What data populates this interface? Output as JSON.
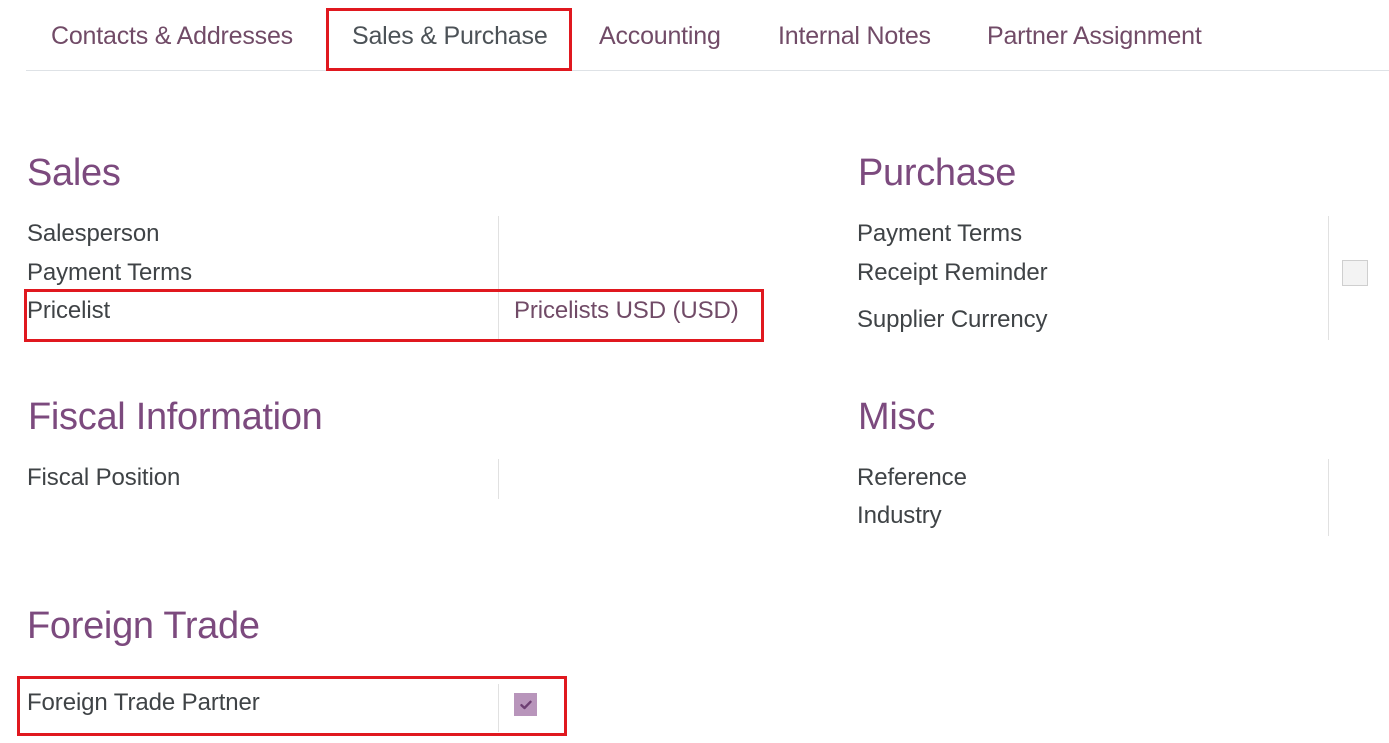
{
  "tabs": [
    {
      "label": "Contacts & Addresses",
      "active": false
    },
    {
      "label": "Sales & Purchase",
      "active": true
    },
    {
      "label": "Accounting",
      "active": false
    },
    {
      "label": "Internal Notes",
      "active": false
    },
    {
      "label": "Partner Assignment",
      "active": false
    }
  ],
  "sales": {
    "title": "Sales",
    "salesperson_label": "Salesperson",
    "payment_terms_label": "Payment Terms",
    "pricelist_label": "Pricelist",
    "pricelist_value": "Pricelists USD (USD)"
  },
  "purchase": {
    "title": "Purchase",
    "payment_terms_label": "Payment Terms",
    "receipt_reminder_label": "Receipt Reminder",
    "receipt_reminder_checked": false,
    "supplier_currency_label": "Supplier Currency"
  },
  "fiscal": {
    "title": "Fiscal Information",
    "fiscal_position_label": "Fiscal Position"
  },
  "misc": {
    "title": "Misc",
    "reference_label": "Reference",
    "industry_label": "Industry"
  },
  "foreign_trade": {
    "title": "Foreign Trade",
    "partner_label": "Foreign Trade Partner",
    "partner_checked": true
  },
  "colors": {
    "brand": "#714b67",
    "heading": "#7c4a7e",
    "highlight": "#e0181f",
    "checkbox_checked": "#b895bb"
  }
}
